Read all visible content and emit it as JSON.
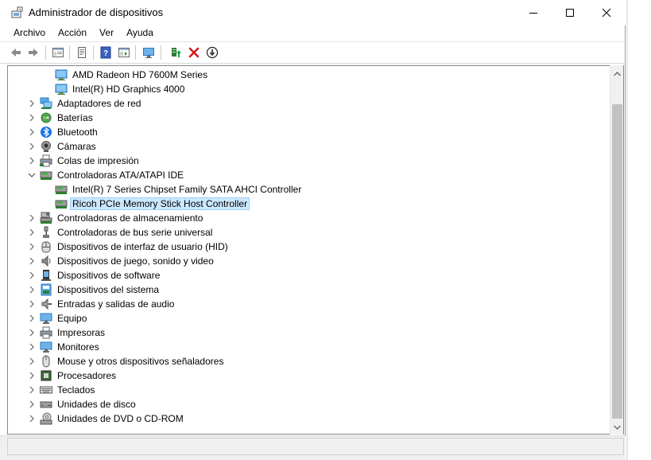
{
  "window": {
    "title": "Administrador de dispositivos",
    "app_icon": "device-manager-icon"
  },
  "menu": [
    "Archivo",
    "Acción",
    "Ver",
    "Ayuda"
  ],
  "toolbar": {
    "buttons": [
      "back-icon",
      "forward-icon",
      "properties-icon",
      "show-hidden-icon",
      "help-icon",
      "view-icon",
      "computer-icon",
      "update-driver-icon",
      "uninstall-icon",
      "disable-icon"
    ]
  },
  "tree": {
    "items": [
      {
        "label": "AMD Radeon HD 7600M Series",
        "level": 2,
        "icon": "display-adapter-icon",
        "expander": "none"
      },
      {
        "label": "Intel(R) HD Graphics 4000",
        "level": 2,
        "icon": "display-adapter-icon",
        "expander": "none"
      },
      {
        "label": "Adaptadores de red",
        "level": 1,
        "icon": "network-adapter-icon",
        "expander": "collapsed"
      },
      {
        "label": "Baterías",
        "level": 1,
        "icon": "battery-icon",
        "expander": "collapsed"
      },
      {
        "label": "Bluetooth",
        "level": 1,
        "icon": "bluetooth-icon",
        "expander": "collapsed"
      },
      {
        "label": "Cámaras",
        "level": 1,
        "icon": "camera-icon",
        "expander": "collapsed"
      },
      {
        "label": "Colas de impresión",
        "level": 1,
        "icon": "print-queue-icon",
        "expander": "collapsed"
      },
      {
        "label": "Controladoras ATA/ATAPI IDE",
        "level": 1,
        "icon": "ide-controller-icon",
        "expander": "expanded"
      },
      {
        "label": "Intel(R) 7 Series Chipset Family SATA AHCI Controller",
        "level": 2,
        "icon": "ide-controller-icon",
        "expander": "none"
      },
      {
        "label": "Ricoh PCIe Memory Stick Host Controller",
        "level": 2,
        "icon": "ide-controller-icon",
        "expander": "none",
        "selected": true
      },
      {
        "label": "Controladoras de almacenamiento",
        "level": 1,
        "icon": "storage-controller-icon",
        "expander": "collapsed"
      },
      {
        "label": "Controladoras de bus serie universal",
        "level": 1,
        "icon": "usb-icon",
        "expander": "collapsed"
      },
      {
        "label": "Dispositivos de interfaz de usuario (HID)",
        "level": 1,
        "icon": "hid-icon",
        "expander": "collapsed"
      },
      {
        "label": "Dispositivos de juego, sonido y video",
        "level": 1,
        "icon": "speaker-icon",
        "expander": "collapsed"
      },
      {
        "label": "Dispositivos de software",
        "level": 1,
        "icon": "software-device-icon",
        "expander": "collapsed"
      },
      {
        "label": "Dispositivos del sistema",
        "level": 1,
        "icon": "system-device-icon",
        "expander": "collapsed"
      },
      {
        "label": "Entradas y salidas de audio",
        "level": 1,
        "icon": "audio-io-icon",
        "expander": "collapsed"
      },
      {
        "label": "Equipo",
        "level": 1,
        "icon": "computer-icon",
        "expander": "collapsed"
      },
      {
        "label": "Impresoras",
        "level": 1,
        "icon": "printer-icon",
        "expander": "collapsed"
      },
      {
        "label": "Monitores",
        "level": 1,
        "icon": "monitor-icon",
        "expander": "collapsed"
      },
      {
        "label": "Mouse y otros dispositivos señaladores",
        "level": 1,
        "icon": "mouse-icon",
        "expander": "collapsed"
      },
      {
        "label": "Procesadores",
        "level": 1,
        "icon": "processor-icon",
        "expander": "collapsed"
      },
      {
        "label": "Teclados",
        "level": 1,
        "icon": "keyboard-icon",
        "expander": "collapsed"
      },
      {
        "label": "Unidades de disco",
        "level": 1,
        "icon": "disk-drive-icon",
        "expander": "collapsed"
      },
      {
        "label": "Unidades de DVD o CD-ROM",
        "level": 1,
        "icon": "dvd-drive-icon",
        "expander": "collapsed"
      }
    ]
  },
  "colors": {
    "selection_bg": "#cce8ff",
    "selection_border": "#99d1ff",
    "monitor_blue": "#2b79c2",
    "uninstall_red": "#d41a1a"
  }
}
